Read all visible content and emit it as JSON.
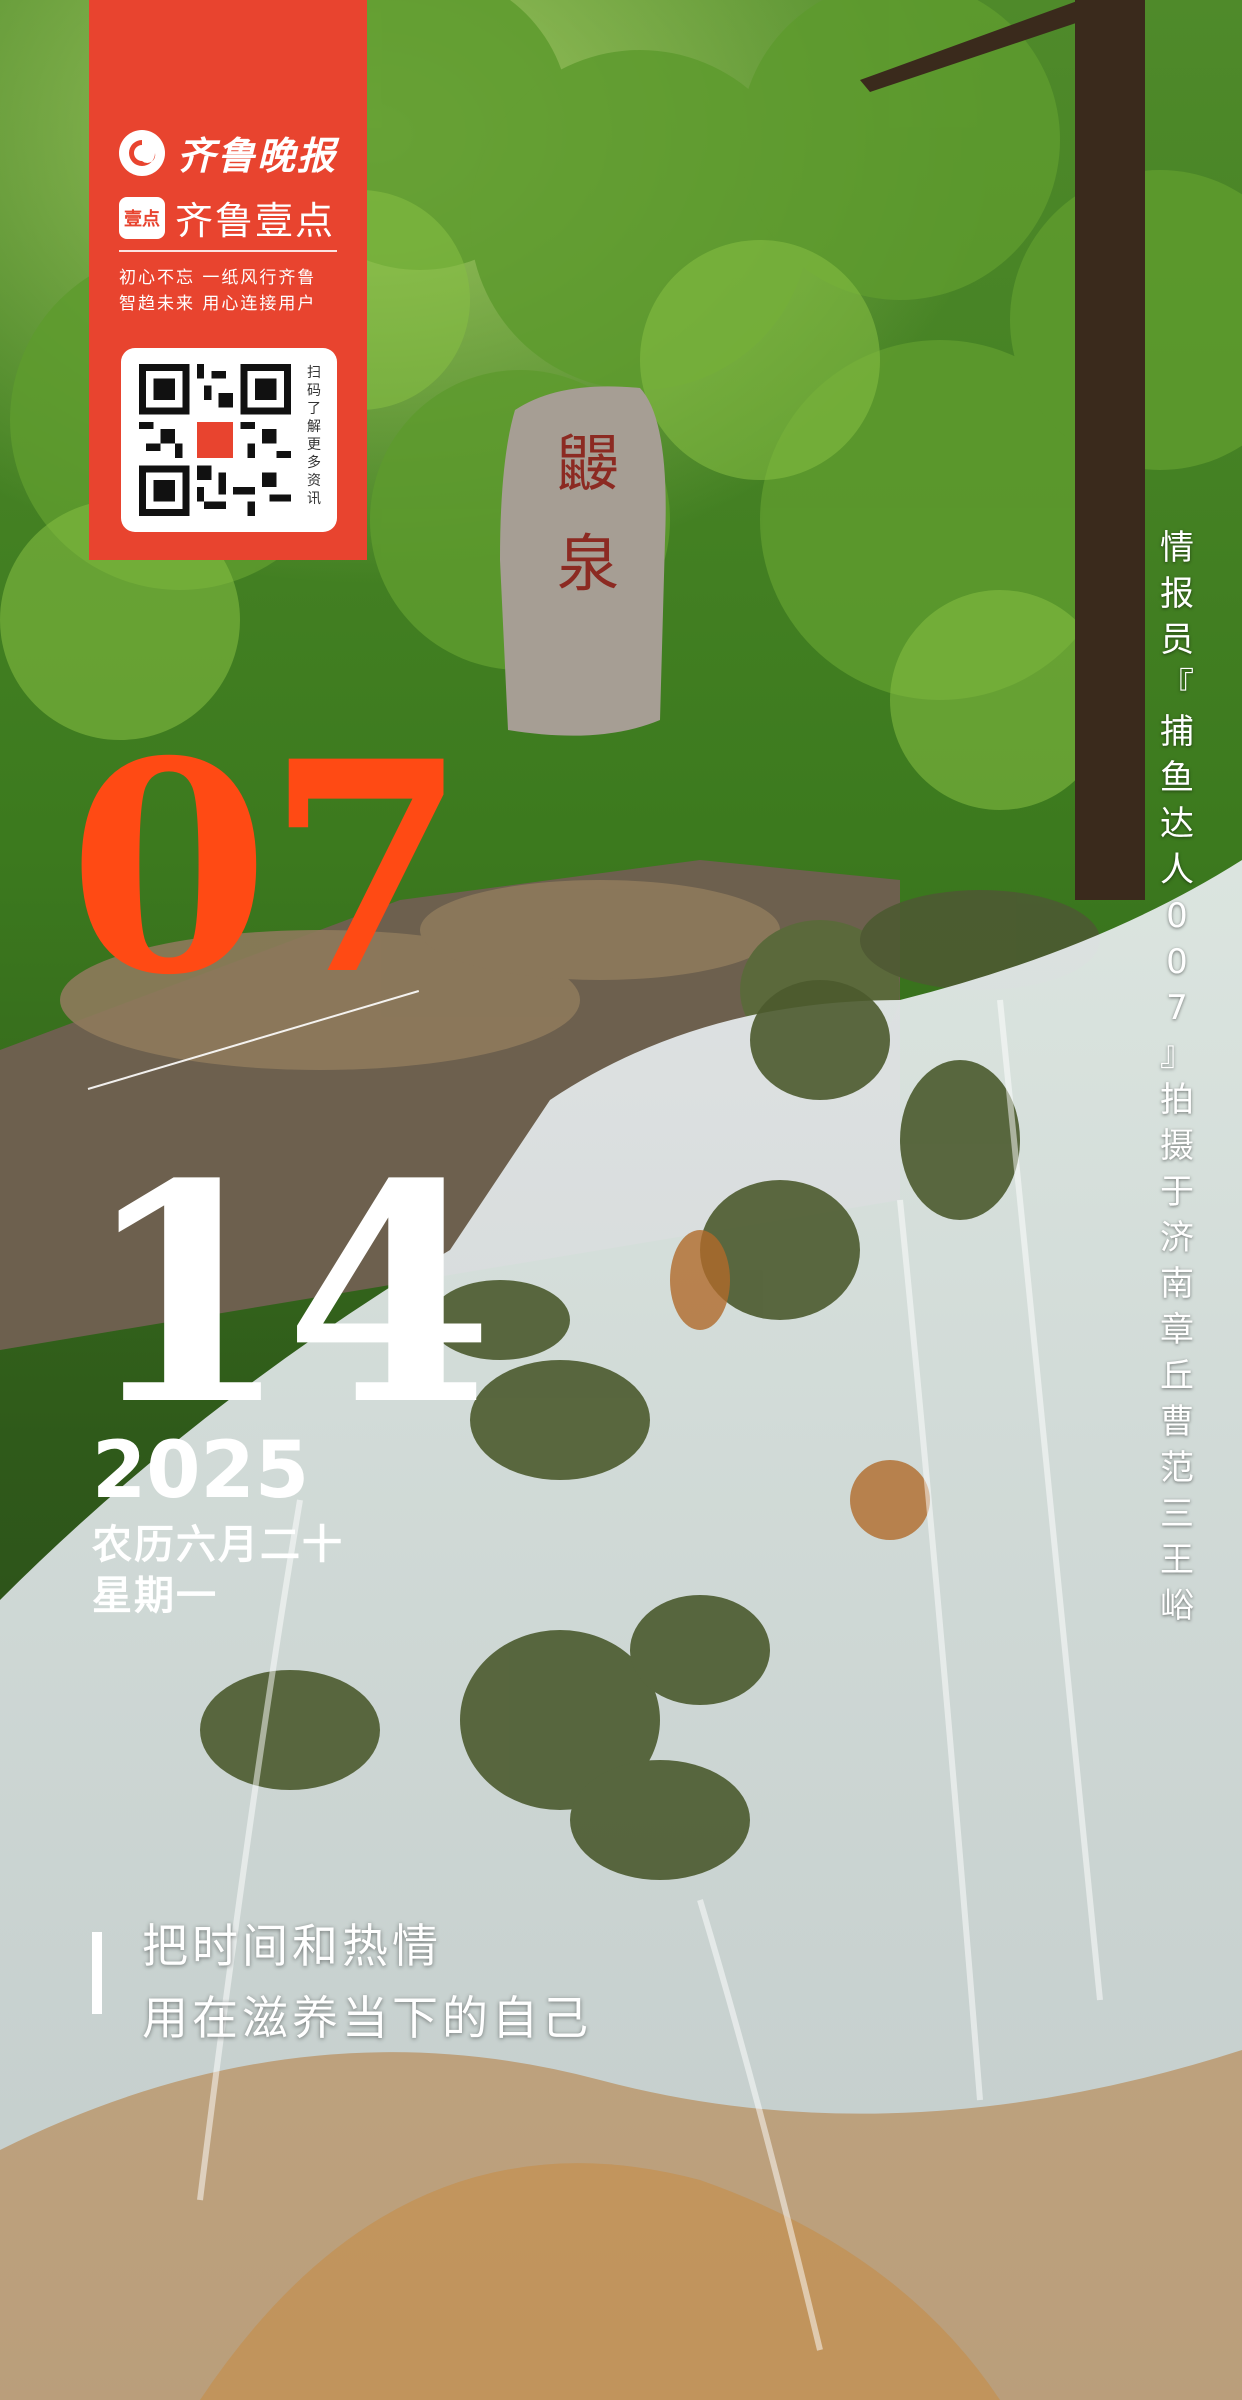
{
  "brand": {
    "newspaper_name": "齐鲁晚报",
    "app_badge": "壹点",
    "app_name": "齐鲁壹点",
    "slogan_line1": "初心不忘  一纸风行齐鲁",
    "slogan_line2": "智趋未来  用心连接用户",
    "qr_hint": "扫码了解更多资讯"
  },
  "stone_inscription": "鼹泉",
  "date": {
    "month": "07",
    "day": "14",
    "year": "2025",
    "lunar": "农历六月二十",
    "weekday": "星期一"
  },
  "caption": "情报员『捕鱼达人007』拍摄于济南章丘曹范三王峪",
  "quote": {
    "line1": "把时间和热情",
    "line2": "用在滋养当下的自己"
  },
  "colors": {
    "brand_red": "#e8442f",
    "month_orange": "#ff4a14",
    "text_white": "#ffffff"
  }
}
